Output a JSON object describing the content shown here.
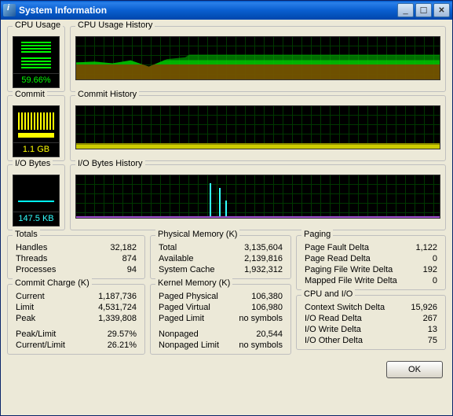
{
  "window": {
    "title": "System Information"
  },
  "cpu": {
    "gauge": {
      "label": "CPU Usage",
      "value": "59.66%"
    },
    "history": {
      "label": "CPU Usage History"
    }
  },
  "commit": {
    "gauge": {
      "label": "Commit",
      "value": "1.1 GB"
    },
    "history": {
      "label": "Commit History"
    }
  },
  "io": {
    "gauge": {
      "label": "I/O Bytes",
      "value": "147.5  KB"
    },
    "history": {
      "label": "I/O Bytes History"
    }
  },
  "totals": {
    "label": "Totals",
    "items": [
      {
        "k": "Handles",
        "v": "32,182"
      },
      {
        "k": "Threads",
        "v": "874"
      },
      {
        "k": "Processes",
        "v": "94"
      }
    ]
  },
  "commitCharge": {
    "label": "Commit Charge (K)",
    "items": [
      {
        "k": "Current",
        "v": "1,187,736"
      },
      {
        "k": "Limit",
        "v": "4,531,724"
      },
      {
        "k": "Peak",
        "v": "1,339,808"
      },
      {
        "k": "Peak/Limit",
        "v": "29.57%"
      },
      {
        "k": "Current/Limit",
        "v": "26.21%"
      }
    ]
  },
  "physicalMemory": {
    "label": "Physical Memory (K)",
    "items": [
      {
        "k": "Total",
        "v": "3,135,604"
      },
      {
        "k": "Available",
        "v": "2,139,816"
      },
      {
        "k": "System Cache",
        "v": "1,932,312"
      }
    ]
  },
  "kernelMemory": {
    "label": "Kernel Memory (K)",
    "items": [
      {
        "k": "Paged Physical",
        "v": "106,380"
      },
      {
        "k": "Paged Virtual",
        "v": "106,980"
      },
      {
        "k": "Paged Limit",
        "v": "no symbols"
      },
      {
        "k": "Nonpaged",
        "v": "20,544"
      },
      {
        "k": "Nonpaged Limit",
        "v": "no symbols"
      }
    ]
  },
  "paging": {
    "label": "Paging",
    "items": [
      {
        "k": "Page Fault Delta",
        "v": "1,122"
      },
      {
        "k": "Page Read Delta",
        "v": "0"
      },
      {
        "k": "Paging File Write Delta",
        "v": "192"
      },
      {
        "k": "Mapped File Write Delta",
        "v": "0"
      }
    ]
  },
  "cpuAndIo": {
    "label": "CPU and I/O",
    "items": [
      {
        "k": "Context Switch Delta",
        "v": "15,926"
      },
      {
        "k": "I/O Read Delta",
        "v": "267"
      },
      {
        "k": "I/O Write Delta",
        "v": "13"
      },
      {
        "k": "I/O Other Delta",
        "v": "75"
      }
    ]
  },
  "buttons": {
    "ok": "OK"
  },
  "colors": {
    "green": "#00ff00",
    "red": "#c00000",
    "yellow": "#ffff00",
    "cyan": "#33ffff",
    "gridline": "#003800",
    "panel": "#ece9d8"
  }
}
